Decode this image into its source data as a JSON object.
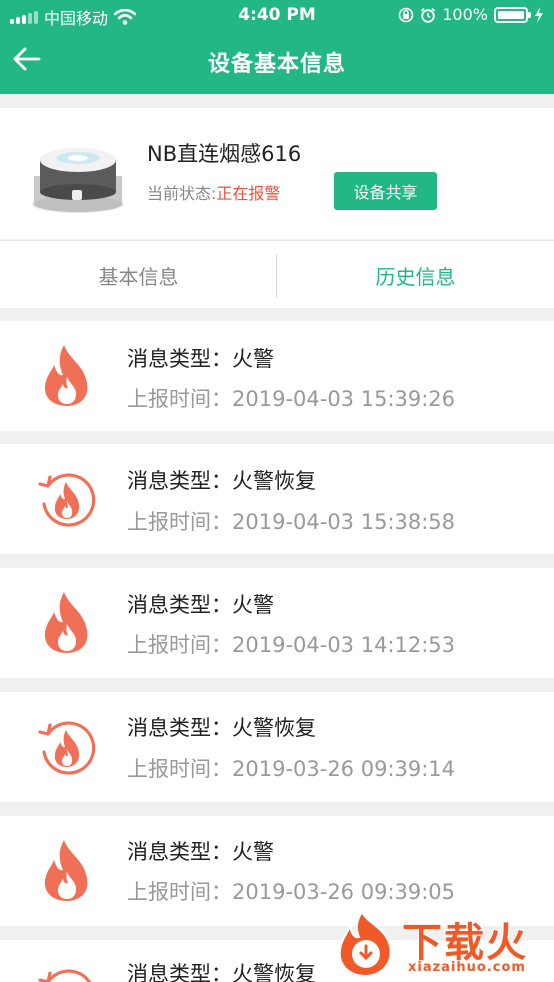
{
  "status_bar": {
    "carrier": "中国移动",
    "time": "4:40 PM",
    "battery": "100%",
    "battery_level": 1.0,
    "icons": [
      "signal-icon",
      "wifi-icon",
      "orientation-lock-icon",
      "alarm-icon",
      "battery-icon",
      "charging-icon"
    ]
  },
  "nav": {
    "title": "设备基本信息",
    "back_icon": "arrow-left-icon"
  },
  "device": {
    "name": "NB直连烟感616",
    "status_label": "当前状态:",
    "status_value": "正在报警",
    "share_label": "设备共享"
  },
  "tabs": {
    "basic": "基本信息",
    "history": "历史信息",
    "active": "history"
  },
  "records": [
    {
      "type_label": "消息类型：",
      "type": "火警",
      "time_label": "上报时间：",
      "time": "2019-04-03 15:39:26",
      "icon": "fire-icon"
    },
    {
      "type_label": "消息类型：",
      "type": "火警恢复",
      "time_label": "上报时间：",
      "time": "2019-04-03 15:38:58",
      "icon": "fire-recovery-icon"
    },
    {
      "type_label": "消息类型：",
      "type": "火警",
      "time_label": "上报时间：",
      "time": "2019-04-03 14:12:53",
      "icon": "fire-icon"
    },
    {
      "type_label": "消息类型：",
      "type": "火警恢复",
      "time_label": "上报时间：",
      "time": "2019-03-26 09:39:14",
      "icon": "fire-recovery-icon"
    },
    {
      "type_label": "消息类型：",
      "type": "火警",
      "time_label": "上报时间：",
      "time": "2019-03-26 09:39:05",
      "icon": "fire-icon"
    },
    {
      "type_label": "消息类型：",
      "type": "火警恢复",
      "icon": "fire-recovery-icon"
    }
  ],
  "watermark": {
    "text": "下载火",
    "subtext": "xiazaihuo.com"
  },
  "colors": {
    "primary": "#22b784",
    "alarm": "#e8533f",
    "fire": "#f07057"
  }
}
